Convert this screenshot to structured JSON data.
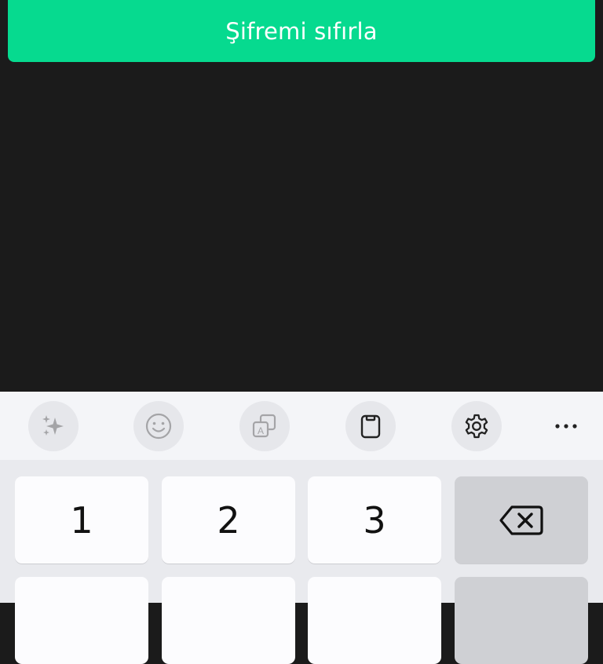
{
  "screen": {
    "background": "#1b1b1b",
    "reset_button": {
      "label": "Şifremi sıfırla",
      "color": "#06da8f"
    }
  },
  "keyboard": {
    "toolbar": [
      {
        "icon": "sparkles-icon",
        "enabled": false
      },
      {
        "icon": "emoji-icon",
        "enabled": false
      },
      {
        "icon": "translate-icon",
        "enabled": false
      },
      {
        "icon": "clipboard-icon",
        "enabled": true
      },
      {
        "icon": "gear-icon",
        "enabled": true
      },
      {
        "icon": "more-dots-icon",
        "enabled": true
      }
    ],
    "keys_row1": [
      "1",
      "2",
      "3"
    ],
    "backspace_icon": "backspace-icon"
  }
}
